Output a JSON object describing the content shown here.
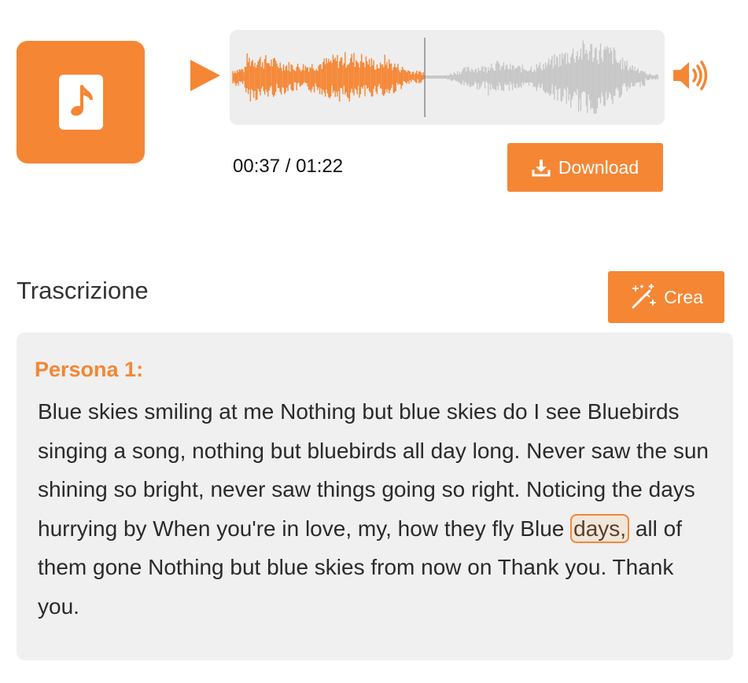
{
  "player": {
    "thumbnail_icon": "music-note-icon",
    "play_icon": "play-icon",
    "volume_icon": "volume-icon",
    "progress": 0.4512,
    "time_display": "00:37 / 01:22",
    "download_label": "Download",
    "download_icon": "download-icon",
    "colors": {
      "accent": "#f58634",
      "played_wave": "#f58634",
      "unplayed_wave": "#c6c6c6"
    }
  },
  "transcript": {
    "title": "Trascrizione",
    "create_label": "Crea",
    "create_icon": "magic-wand-icon",
    "speaker": "Persona 1:",
    "text_before": "Blue skies smiling at me Nothing but blue skies do I see Bluebirds singing a song, nothing but bluebirds all day long. Never saw the sun shining so bright, never saw things going so right. Noticing the days hurrying by When you're in love, my, how they fly Blue ",
    "active_word": "days,",
    "text_after": " all of them gone Nothing but blue skies from now on Thank you. Thank you."
  }
}
